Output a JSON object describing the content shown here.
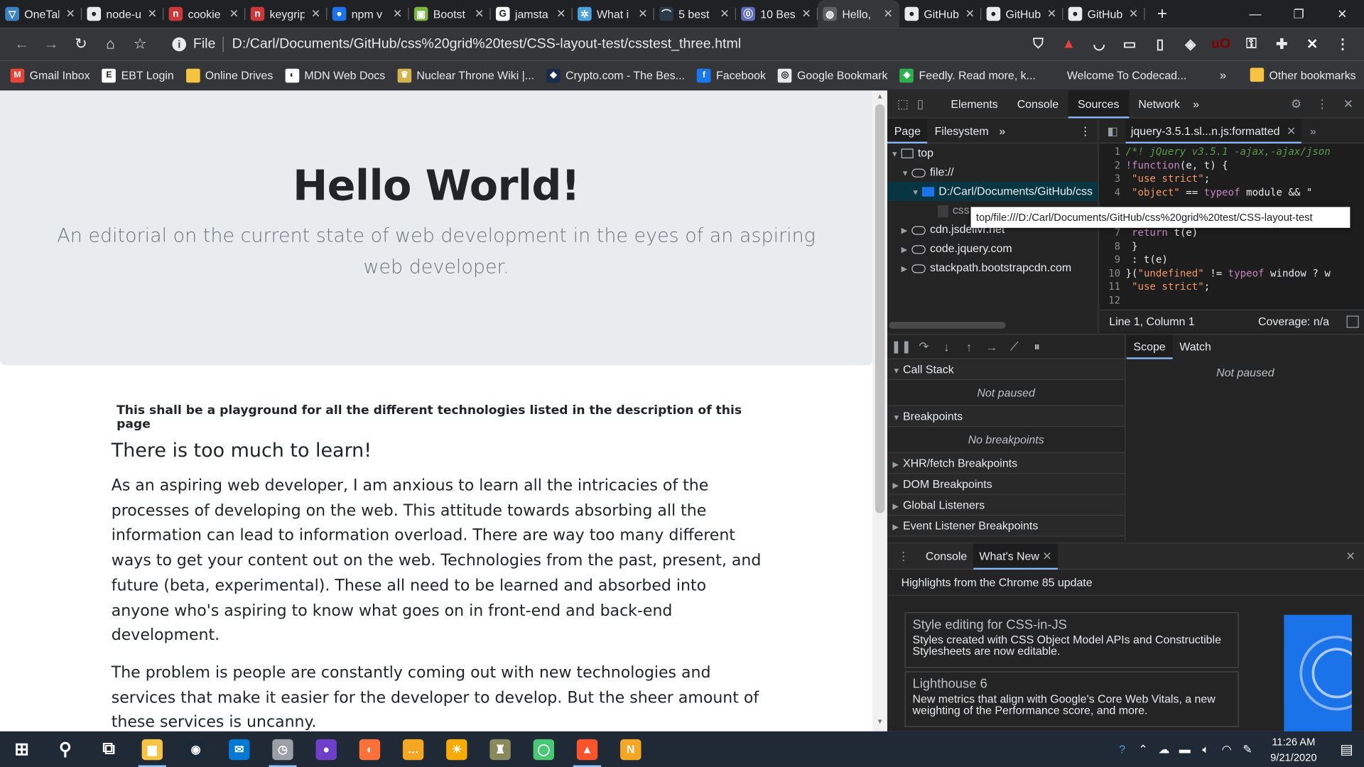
{
  "browser": {
    "tabs": [
      {
        "label": "OneTab",
        "favicon": "onetab-icon",
        "color": "#3b82c4",
        "glyph": "▽"
      },
      {
        "label": "node-u",
        "favicon": "github-icon",
        "color": "#e8eaed",
        "glyph": "●"
      },
      {
        "label": "cookie",
        "favicon": "npm-icon",
        "color": "#cb3837",
        "glyph": "n"
      },
      {
        "label": "keygrip",
        "favicon": "npm-icon",
        "color": "#cb3837",
        "glyph": "n"
      },
      {
        "label": "npm v",
        "favicon": "npm-icon",
        "color": "#1a73e8",
        "glyph": "●"
      },
      {
        "label": "Bootst",
        "favicon": "bootstrap-icon",
        "color": "#7cb342",
        "glyph": "▣"
      },
      {
        "label": "jamsta",
        "favicon": "google-icon",
        "color": "#ffffff",
        "glyph": "G"
      },
      {
        "label": "What i",
        "favicon": "settings-icon",
        "color": "#4aa3df",
        "glyph": "✲"
      },
      {
        "label": "5 best",
        "favicon": "site-icon",
        "color": "#2b3a4a",
        "glyph": "⌒"
      },
      {
        "label": "10 Bes",
        "favicon": "site-icon",
        "color": "#5c6bc0",
        "glyph": "⓪"
      },
      {
        "label": "Hello, ",
        "favicon": "globe-icon",
        "color": "#5f6368",
        "glyph": "◍",
        "active": true
      },
      {
        "label": "GitHub",
        "favicon": "github-icon",
        "color": "#e8eaed",
        "glyph": "●"
      },
      {
        "label": "GitHub",
        "favicon": "github-icon",
        "color": "#e8eaed",
        "glyph": "●"
      },
      {
        "label": "GitHub",
        "favicon": "github-icon",
        "color": "#e8eaed",
        "glyph": "●"
      }
    ],
    "tab_close": "✕",
    "new_tab": "+",
    "window_controls": {
      "minimize": "—",
      "restore": "❐",
      "close": "✕"
    },
    "nav": {
      "back": "←",
      "forward": "→",
      "reload": "↻",
      "home": "⌂",
      "bookmark": "☆"
    },
    "omnibox": {
      "info": "i",
      "scheme": "File",
      "url": "D:/Carl/Documents/GitHub/css%20grid%20test/CSS-layout-test/csstest_three.html"
    },
    "extensions": [
      {
        "name": "brave-shield-icon",
        "color": "#5f6368",
        "glyph": "⛉"
      },
      {
        "name": "brave-rewards-icon",
        "color": "#e8423f",
        "glyph": "▲"
      },
      {
        "name": "pocket-icon",
        "color": "#5f6368",
        "glyph": "◡"
      },
      {
        "name": "screenshot-icon",
        "color": "#5f6368",
        "glyph": "▭"
      },
      {
        "name": "bookmark-ext-icon",
        "color": "#5f6368",
        "glyph": "▯"
      },
      {
        "name": "shield-ext-icon",
        "color": "#5f6368",
        "glyph": "◈"
      },
      {
        "name": "ublock-icon",
        "color": "#800000",
        "glyph": "uO"
      },
      {
        "name": "key-ext-icon",
        "color": "#5f6368",
        "glyph": "⚿"
      },
      {
        "name": "puzzle-icon",
        "color": "#5f6368",
        "glyph": "✚"
      },
      {
        "name": "profile-icon",
        "color": "#ffffff",
        "glyph": "✕"
      },
      {
        "name": "menu-icon",
        "color": "#5f6368",
        "glyph": "⋮"
      }
    ],
    "bookmarks": [
      {
        "label": "Gmail Inbox",
        "icon": "gmail-icon",
        "color": "#ea4335",
        "glyph": "M"
      },
      {
        "label": "EBT Login",
        "icon": "ebt-icon",
        "color": "#ffffff",
        "glyph": "E"
      },
      {
        "label": "Online Drives",
        "icon": "folder-icon",
        "color": "#f6c342",
        "glyph": ""
      },
      {
        "label": "MDN Web Docs",
        "icon": "mdn-icon",
        "color": "#ffffff",
        "glyph": "◐"
      },
      {
        "label": "Nuclear Throne Wiki |...",
        "icon": "wiki-icon",
        "color": "#d4b24c",
        "glyph": "♛"
      },
      {
        "label": "Crypto.com - The Bes...",
        "icon": "crypto-icon",
        "color": "#1a2b4c",
        "glyph": "◆"
      },
      {
        "label": "Facebook",
        "icon": "facebook-icon",
        "color": "#1877f2",
        "glyph": "f"
      },
      {
        "label": "Google Bookmark",
        "icon": "chrome-icon",
        "color": "#e8eaed",
        "glyph": "◎"
      },
      {
        "label": "Feedly. Read more, k...",
        "icon": "feedly-icon",
        "color": "#2bb24c",
        "glyph": "◆"
      },
      {
        "label": "Welcome To Codecad...",
        "icon": "codecademy-icon",
        "color": "#35363a",
        "glyph": ""
      }
    ],
    "bookmarks_more": "»",
    "other_bookmarks": "Other bookmarks"
  },
  "page": {
    "title": "Hello World!",
    "lead": "An editorial on the current state of web development in the eyes of an aspiring web developer.",
    "intro": "This shall be a playground for all the different technologies listed in the description of this page",
    "heading": "There is too much to learn!",
    "paragraphs": [
      "As an aspiring web developer, I am anxious to learn all the intricacies of the processes of developing on the web. This attitude towards absorbing all the information can lead to information overload. There are way too many different ways to get your content out on the web. Technologies from the past, present, and future (beta, experimental). These all need to be learned and absorbed into anyone who's aspiring to know what goes on in front-end and back-end development.",
      "The problem is people are constantly coming out with new technologies and services that make it easier for the developer to develop. But the sheer amount of these services is uncanny."
    ]
  },
  "devtools": {
    "tabs": [
      "Elements",
      "Console",
      "Sources",
      "Network"
    ],
    "active_tab": "Sources",
    "more": "»",
    "navigator_tabs": [
      "Page",
      "Filesystem"
    ],
    "tree": {
      "top": "top",
      "file": "file://",
      "folder": "D:/Carl/Documents/GitHub/css",
      "file_partial": "css",
      "cdn1": "cdn.jsdelivr.net",
      "cdn2": "code.jquery.com",
      "cdn3": "stackpath.bootstrapcdn.com"
    },
    "tooltip": "top/file:///D:/Carl/Documents/GitHub/css%20grid%20test/CSS-layout-test",
    "editor_tab": "jquery-3.5.1.sl...n.js:formatted",
    "code_lines": [
      {
        "n": "1",
        "html": "<span class=\"cm\">/*! jQuery v3.5.1 -ajax,-ajax/json</span>"
      },
      {
        "n": "2",
        "html": "<span class=\"kw\">!function</span><span class=\"fn\">(e, t) {</span>"
      },
      {
        "n": "3",
        "html": "<span class=\"fn\">    </span><span class=\"st\">\"use strict\"</span><span class=\"fn\">;</span>"
      },
      {
        "n": "4",
        "html": "<span class=\"fn\">    </span><span class=\"st\">\"object\"</span><span class=\"fn\"> == </span><span class=\"kw\">typeof</span><span class=\"fn\"> module &amp;&amp; \"</span>"
      },
      {
        "n": "7",
        "html": "<span class=\"fn\">        </span><span class=\"kw\">return</span><span class=\"fn\"> t(e)</span>"
      },
      {
        "n": "8",
        "html": "<span class=\"fn\">    }</span>"
      },
      {
        "n": "9",
        "html": "<span class=\"fn\">    : t(e)</span>"
      },
      {
        "n": "10",
        "html": "<span class=\"fn\">}(</span><span class=\"st\">\"undefined\"</span><span class=\"fn\"> != </span><span class=\"kw\">typeof</span><span class=\"fn\"> window ? w</span>"
      },
      {
        "n": "11",
        "html": "<span class=\"fn\">    </span><span class=\"st\">\"use strict\"</span><span class=\"fn\">;</span>"
      },
      {
        "n": "12",
        "html": ""
      }
    ],
    "status": {
      "position": "Line 1, Column 1",
      "coverage": "Coverage: n/a"
    },
    "scope_tabs": [
      "Scope",
      "Watch"
    ],
    "scope_empty": "Not paused",
    "sections": [
      {
        "label": "Call Stack",
        "open": true,
        "empty": "Not paused"
      },
      {
        "label": "Breakpoints",
        "open": true,
        "empty": "No breakpoints"
      },
      {
        "label": "XHR/fetch Breakpoints",
        "open": false
      },
      {
        "label": "DOM Breakpoints",
        "open": false
      },
      {
        "label": "Global Listeners",
        "open": false
      },
      {
        "label": "Event Listener Breakpoints",
        "open": false
      }
    ],
    "drawer_tabs": [
      "Console",
      "What's New"
    ],
    "drawer_active": "What's New",
    "whats_new_heading": "Highlights from the Chrome 85 update",
    "cards": [
      {
        "title": "Style editing for CSS-in-JS",
        "desc": "Styles created with CSS Object Model APIs and Constructible Stylesheets are now editable."
      },
      {
        "title": "Lighthouse 6",
        "desc": "New metrics that align with Google's Core Web Vitals, a new weighting of the Performance score, and more."
      }
    ]
  },
  "taskbar": {
    "apps": [
      {
        "name": "windows-start-icon",
        "color": "transparent",
        "glyph": "⊞"
      },
      {
        "name": "search-icon",
        "color": "transparent",
        "glyph": "⚲"
      },
      {
        "name": "task-view-icon",
        "color": "transparent",
        "glyph": "⧉"
      },
      {
        "name": "file-explorer-icon",
        "color": "#f6c342",
        "glyph": "▆"
      },
      {
        "name": "steam-icon",
        "color": "#1b2838",
        "glyph": "◉"
      },
      {
        "name": "mail-icon",
        "color": "#0078d4",
        "glyph": "✉"
      },
      {
        "name": "clock-app-icon",
        "color": "#9aa0a6",
        "glyph": "◷"
      },
      {
        "name": "github-desktop-icon",
        "color": "#6e40c9",
        "glyph": "●"
      },
      {
        "name": "firefox-icon",
        "color": "#ff7139",
        "glyph": "◐"
      },
      {
        "name": "app-dots-icon",
        "color": "#f5a623",
        "glyph": "…"
      },
      {
        "name": "weather-icon",
        "color": "#f9ab00",
        "glyph": "☀"
      },
      {
        "name": "castle-app-icon",
        "color": "#8a8a5c",
        "glyph": "♜"
      },
      {
        "name": "gotomeeting-icon",
        "color": "#48c774",
        "glyph": "◯"
      },
      {
        "name": "brave-icon",
        "color": "#fb542b",
        "glyph": "▲"
      },
      {
        "name": "norton-icon",
        "color": "#f5a623",
        "glyph": "N"
      }
    ],
    "tray": {
      "help": "?",
      "chevron": "⌃",
      "time": "11:26 AM",
      "date": "9/21/2020",
      "notification": "▤"
    }
  }
}
